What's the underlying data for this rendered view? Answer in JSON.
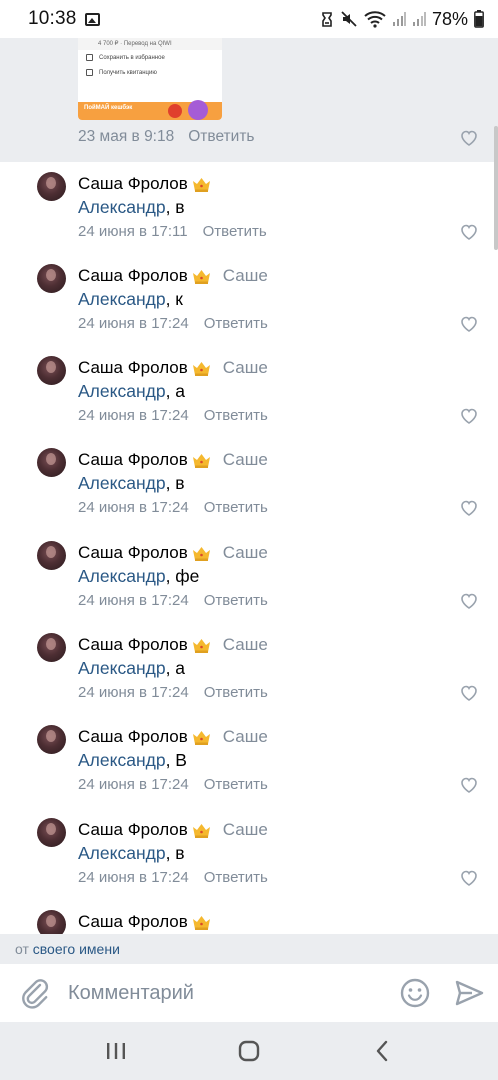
{
  "status_bar": {
    "time": "10:38",
    "battery": "78%"
  },
  "top_post": {
    "thumb_header": "4 700 ₽ · Перевод на QIWI",
    "thumb_items": [
      "Сохранить в избранное",
      "Получить квитанцию"
    ],
    "thumb_banner": "ПойМАЙ кешбэк",
    "date": "23 мая в 9:18",
    "reply": "Ответить"
  },
  "comments": [
    {
      "name": "Саша Фролов",
      "to": "",
      "mention": "Александр",
      "text": ", в",
      "date": "24 июня в 17:11",
      "reply": "Ответить"
    },
    {
      "name": "Саша Фролов",
      "to": "Саше",
      "mention": "Александр",
      "text": ", к",
      "date": "24 июня в 17:24",
      "reply": "Ответить"
    },
    {
      "name": "Саша Фролов",
      "to": "Саше",
      "mention": "Александр",
      "text": ", а",
      "date": "24 июня в 17:24",
      "reply": "Ответить"
    },
    {
      "name": "Саша Фролов",
      "to": "Саше",
      "mention": "Александр",
      "text": ", в",
      "date": "24 июня в 17:24",
      "reply": "Ответить"
    },
    {
      "name": "Саша Фролов",
      "to": "Саше",
      "mention": "Александр",
      "text": ", фе",
      "date": "24 июня в 17:24",
      "reply": "Ответить"
    },
    {
      "name": "Саша Фролов",
      "to": "Саше",
      "mention": "Александр",
      "text": ", а",
      "date": "24 июня в 17:24",
      "reply": "Ответить"
    },
    {
      "name": "Саша Фролов",
      "to": "Саше",
      "mention": "Александр",
      "text": ", В",
      "date": "24 июня в 17:24",
      "reply": "Ответить"
    },
    {
      "name": "Саша Фролов",
      "to": "Саше",
      "mention": "Александр",
      "text": ", в",
      "date": "24 июня в 17:24",
      "reply": "Ответить"
    },
    {
      "name": "Саша Фролов",
      "to": "",
      "mention": "",
      "text": "",
      "date": "",
      "reply": ""
    }
  ],
  "from_bar": {
    "prefix": "от",
    "link": "своего имени"
  },
  "compose": {
    "placeholder": "Комментарий"
  },
  "icons": {
    "attach": "paperclip-icon",
    "emoji": "smile-icon",
    "send": "send-icon",
    "like": "heart-icon",
    "crown": "crown-emoji-icon"
  },
  "colors": {
    "link": "#2a5885",
    "secondary": "#818c99",
    "background_gray": "#ebedf0",
    "crown": "#f5b82e"
  }
}
